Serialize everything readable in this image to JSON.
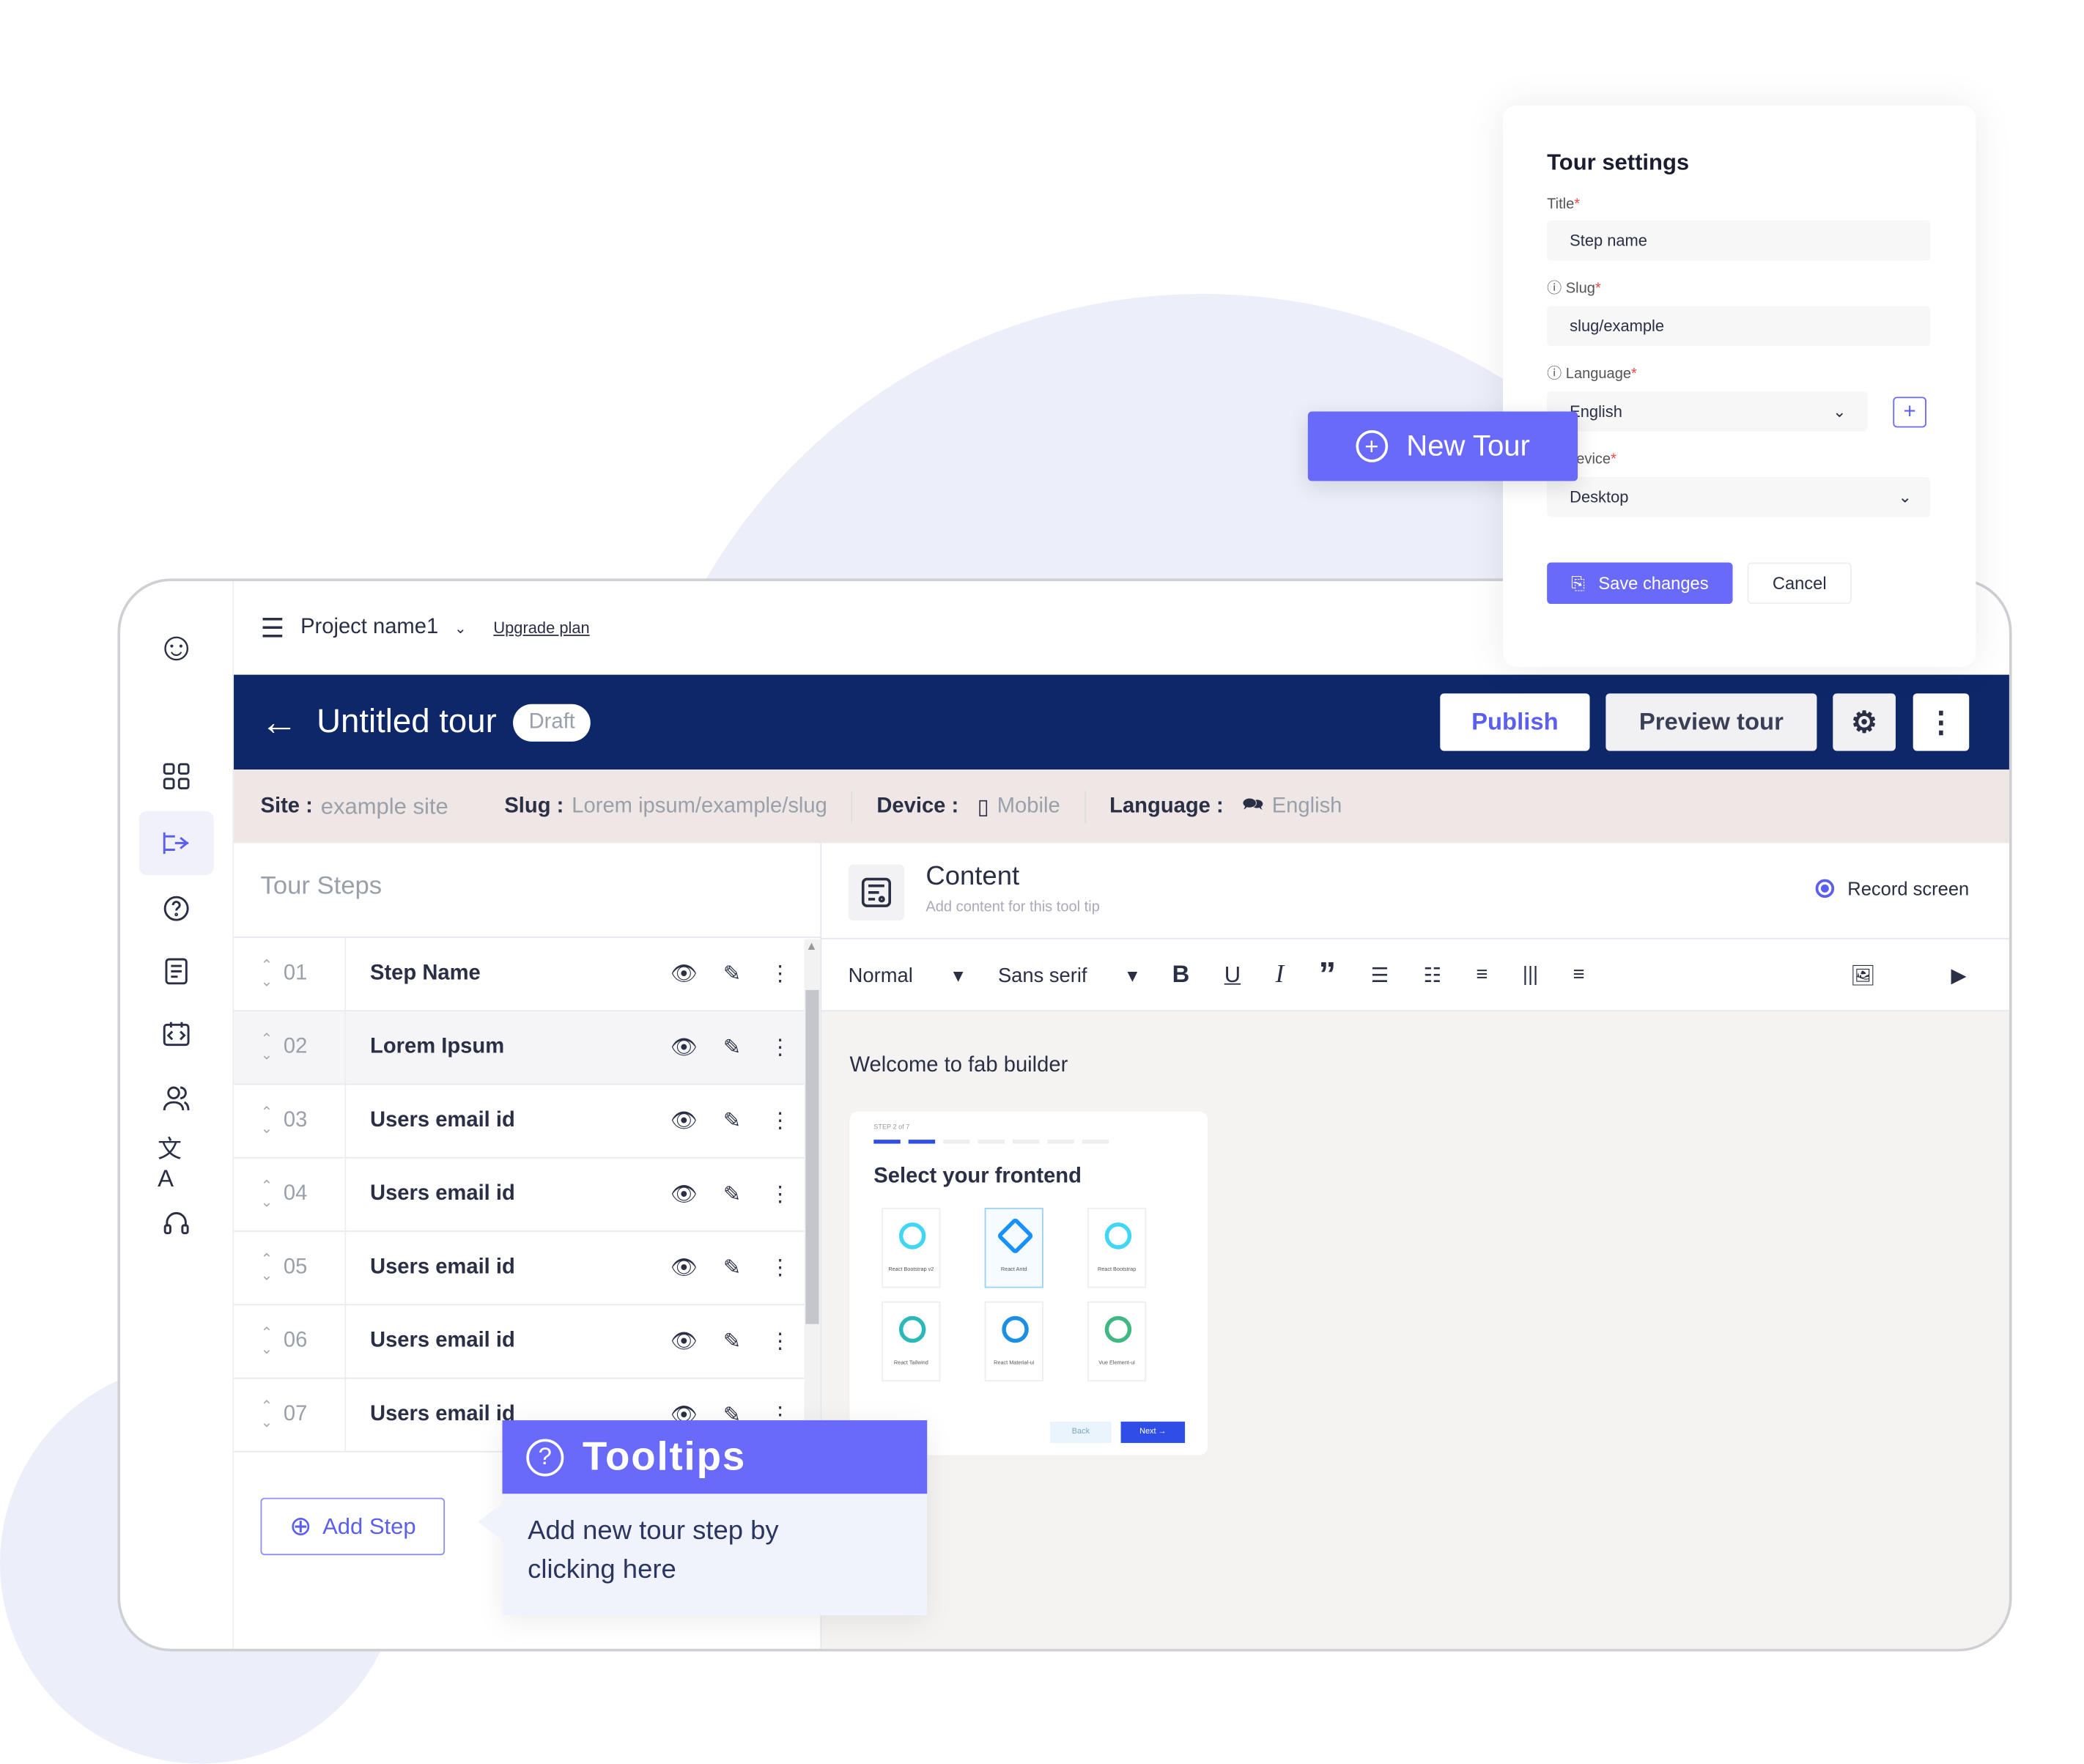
{
  "colors": {
    "accent": "#6a6afa",
    "navy": "#0d2769",
    "info_bar": "#efe7e6"
  },
  "topbar": {
    "project": "Project name1",
    "upgrade": "Upgrade plan"
  },
  "header": {
    "title": "Untitled tour",
    "badge": "Draft",
    "publish": "Publish",
    "preview": "Preview tour"
  },
  "info": {
    "site_label": "Site :",
    "site": "example site",
    "slug_label": "Slug :",
    "slug": "Lorem ipsum/example/slug",
    "device_label": "Device :",
    "device": "Mobile",
    "language_label": "Language :",
    "language": "English"
  },
  "steps": {
    "title": "Tour Steps",
    "add": "Add Step",
    "items": [
      {
        "num": "01",
        "name": "Step Name"
      },
      {
        "num": "02",
        "name": "Lorem Ipsum"
      },
      {
        "num": "03",
        "name": "Users email id"
      },
      {
        "num": "04",
        "name": "Users email id"
      },
      {
        "num": "05",
        "name": "Users email id"
      },
      {
        "num": "06",
        "name": "Users email id"
      },
      {
        "num": "07",
        "name": "Users email id"
      }
    ]
  },
  "content": {
    "title": "Content",
    "subtitle": "Add content for this tool tip",
    "record": "Record screen",
    "format": "Normal",
    "font": "Sans serif",
    "welcome": "Welcome to fab builder"
  },
  "preview": {
    "step": "STEP 2 of 7",
    "title": "Select your frontend",
    "options": [
      "React Bootstrap v2",
      "React Antd",
      "React Bootstrap",
      "React Tailwind",
      "React Material-ui",
      "Vue Element-ui"
    ],
    "selected": "React Antd",
    "back": "Back",
    "next": "Next"
  },
  "tooltip": {
    "title": "Tooltips",
    "text": "Add new tour step by clicking here"
  },
  "new_tour": "New Tour",
  "settings": {
    "title": "Tour settings",
    "title_label": "Title",
    "title_value": "Step name",
    "slug_label": "Slug",
    "slug_value": "slug/example",
    "language_label": "Language",
    "language_value": "English",
    "device_label": "Device",
    "device_value": "Desktop",
    "save": "Save changes",
    "cancel": "Cancel"
  }
}
